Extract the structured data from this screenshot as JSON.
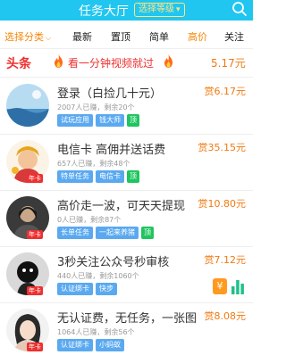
{
  "header": {
    "title": "任务大厅",
    "level_button": "选择等级"
  },
  "tabs": {
    "category": "选择分类",
    "items": [
      "最新",
      "置顶",
      "简单",
      "高价",
      "关注"
    ]
  },
  "headline": {
    "tag": "头条",
    "text": "看一分钟视频就过",
    "price": "5.17元"
  },
  "tasks": [
    {
      "name": "登录（白捡几十元）",
      "meta": "2007人已赚，剩余20个",
      "chips": [
        "试玩应用",
        "钱大师",
        "顶"
      ],
      "reward": "赏6.17元",
      "badge": ""
    },
    {
      "name": "电信卡 高佣并送话费",
      "meta": "657人已赚，剩余48个",
      "chips": [
        "特单任务",
        "电信卡",
        "顶"
      ],
      "reward": "赏35.15元",
      "badge": "年卡"
    },
    {
      "name": "高价走一波，可天天提现",
      "meta": "0人已赚，剩余87个",
      "chips": [
        "长单任务",
        "一起来养猪",
        "顶"
      ],
      "reward": "赏10.80元",
      "badge": "年卡"
    },
    {
      "name": "3秒关注公众号秒审核",
      "meta": "440人已赚，剩余1060个",
      "chips": [
        "认证绑卡",
        "快步"
      ],
      "reward": "赏7.12元",
      "badge": "年卡"
    },
    {
      "name": "无认证费，无任务，一张图",
      "meta": "1064人已赚，剩余56个",
      "chips": [
        "认证绑卡",
        "小蚂蚁"
      ],
      "reward": "赏8.08元",
      "badge": "年卡"
    }
  ],
  "floating": {
    "coin_symbol": "¥"
  }
}
